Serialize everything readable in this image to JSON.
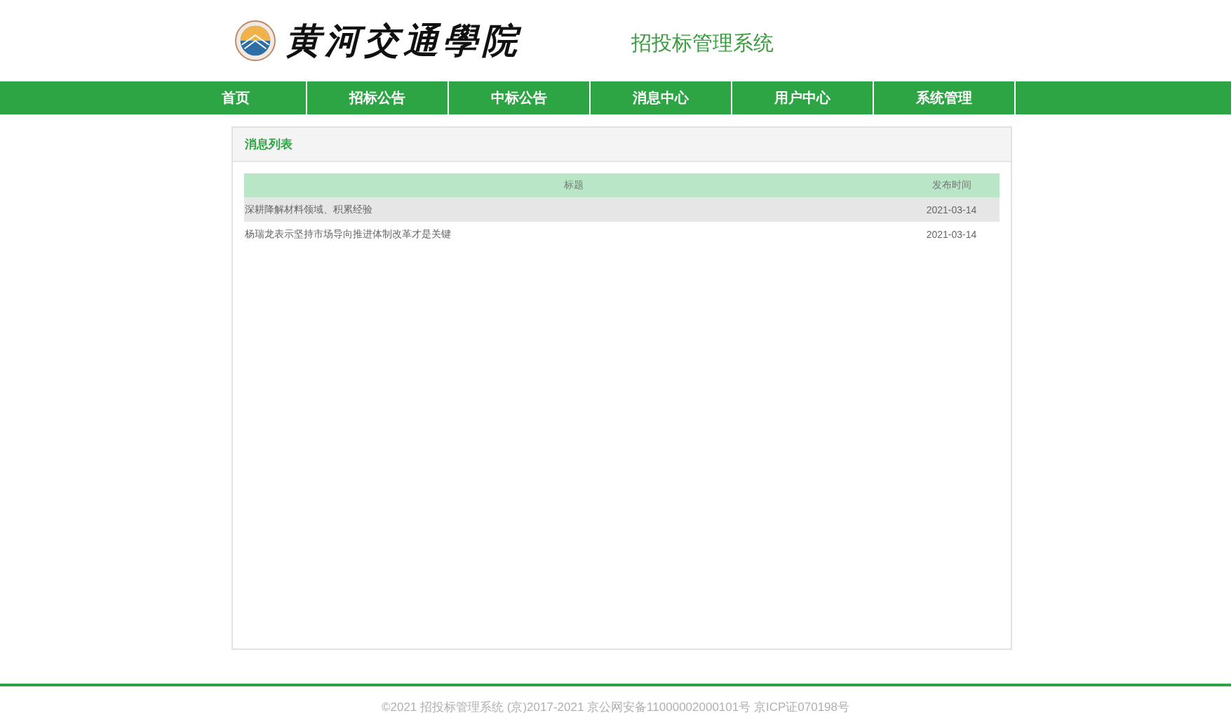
{
  "header": {
    "school_name": "黄河交通學院",
    "system_title": "招投标管理系统"
  },
  "nav": [
    {
      "label": "首页",
      "selected": false
    },
    {
      "label": "招标公告",
      "selected": false
    },
    {
      "label": "中标公告",
      "selected": false
    },
    {
      "label": "消息中心",
      "selected": false
    },
    {
      "label": "用户中心",
      "selected": false
    },
    {
      "label": "系统管理",
      "selected": false
    }
  ],
  "panel": {
    "title": "消息列表",
    "table": {
      "columns": [
        "标题",
        "发布时间"
      ],
      "rows": [
        {
          "title": "深耕降解材料领域、积累经验",
          "date": "2021-03-14",
          "selected": true
        },
        {
          "title": "杨瑞龙表示坚持市场导向推进体制改革才是关键",
          "date": "2021-03-14",
          "selected": false
        }
      ]
    }
  },
  "footer": {
    "text": "©2021 招投标管理系统 (京)2017-2021 京公网安备11000002000101号 京ICP证070198号"
  }
}
